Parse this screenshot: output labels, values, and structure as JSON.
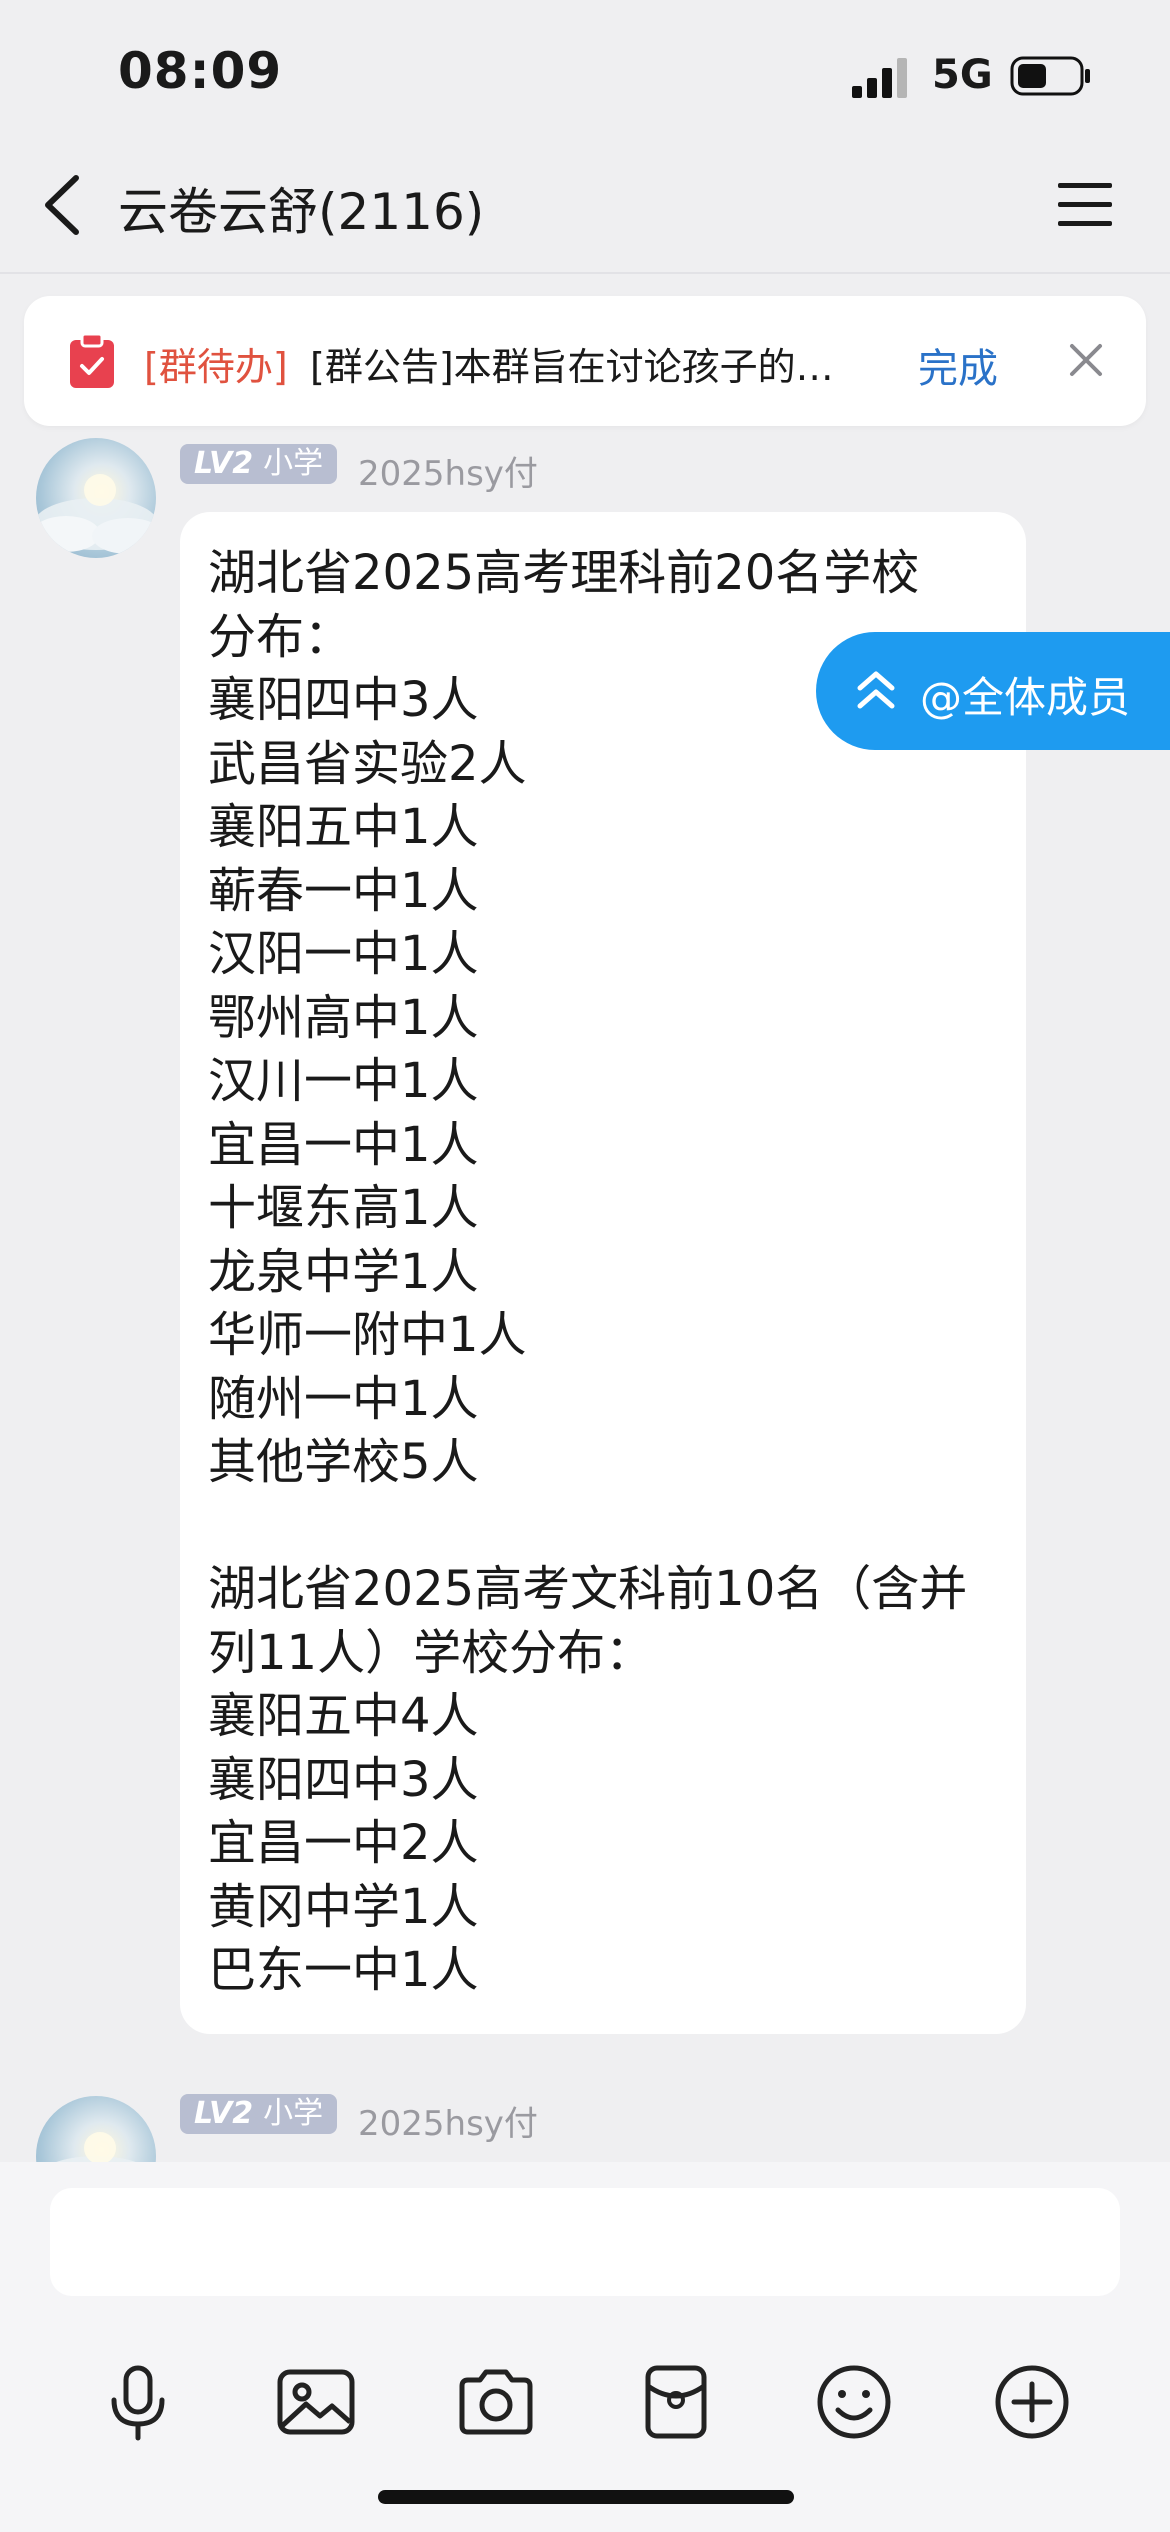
{
  "status_bar": {
    "time": "08:09",
    "network": "5G"
  },
  "nav": {
    "title": "云卷云舒(2116)"
  },
  "todo_banner": {
    "tag": "[群待办]",
    "text": "[群公告]本群旨在讨论孩子的…",
    "done_label": "完成"
  },
  "messages": [
    {
      "level": "LV2",
      "grade": "小学",
      "sender": "2025hsy付",
      "text": "湖北省2025高考理科前20名学校\n分布：\n襄阳四中3人\n武昌省实验2人\n襄阳五中1人\n蕲春一中1人\n汉阳一中1人\n鄂州高中1人\n汉川一中1人\n宜昌一中1人\n十堰东高1人\n龙泉中学1人\n华师一附中1人\n随州一中1人\n其他学校5人\n\n湖北省2025高考文科前10名（含并\n列11人）学校分布：\n襄阳五中4人\n襄阳四中3人\n宜昌一中2人\n黄冈中学1人\n巴东一中1人"
    },
    {
      "level": "LV2",
      "grade": "小学",
      "sender": "2025hsy付"
    }
  ],
  "at_all": {
    "label": "@全体成员"
  },
  "composer": {
    "placeholder": ""
  },
  "toolbar": {
    "icons": [
      "microphone-icon",
      "image-icon",
      "camera-icon",
      "red-packet-icon",
      "emoji-icon",
      "plus-icon"
    ]
  },
  "colors": {
    "background": "#efeff1",
    "accent_blue": "#1e9bf0",
    "todo_red": "#e0523f",
    "link_blue": "#2a72c8",
    "level_badge": "#b8bed1"
  }
}
